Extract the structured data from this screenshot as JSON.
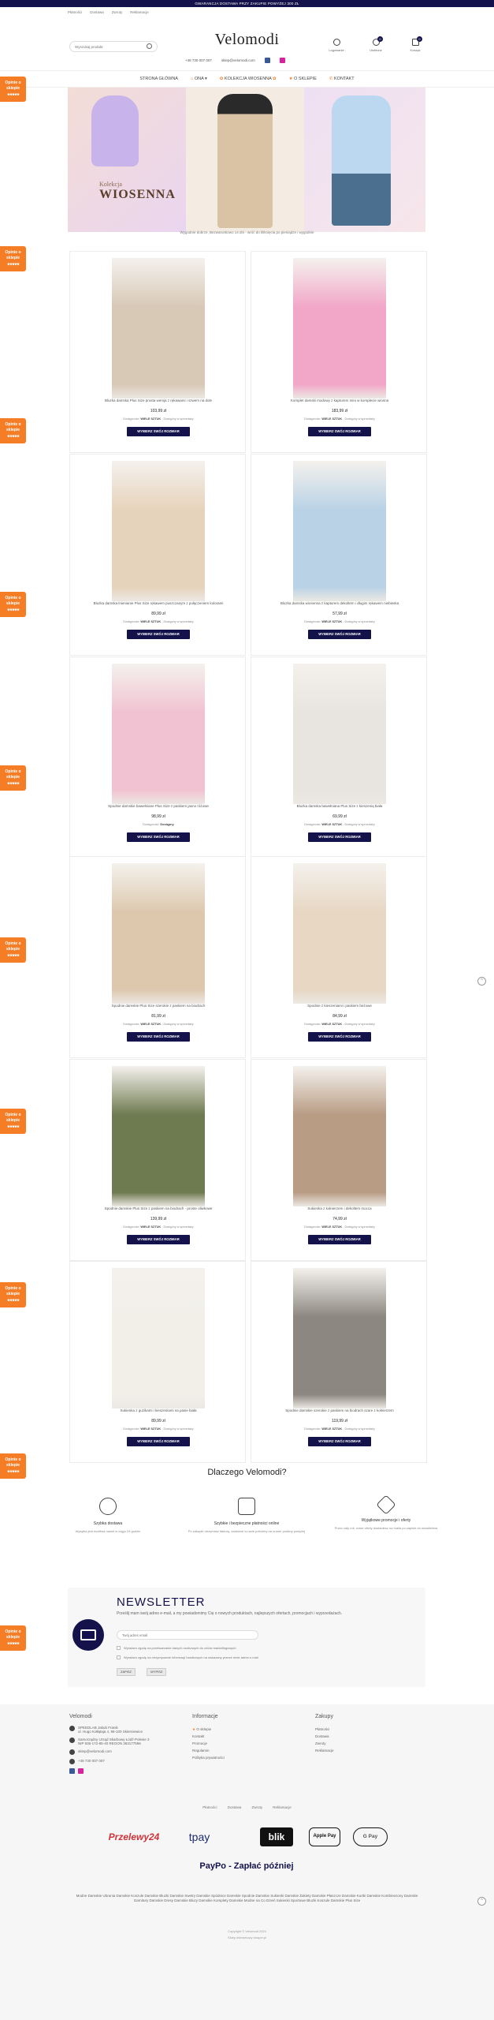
{
  "topbar": {
    "text": "GWARANCJA DOSTAWA PRZY ZAKUPIE POWYŻEJ 300 ZŁ"
  },
  "header": {
    "toplinks": [
      "Płatności",
      "Dostawa",
      "Zwroty",
      "Reklamacje"
    ],
    "logo": "Velomodi",
    "search_placeholder": "Wyszukaj produkt",
    "phone": "+48 730 007 007",
    "email": "sklep@velomodi.com",
    "icons": [
      {
        "name": "user-icon",
        "label": "Logowanie"
      },
      {
        "name": "heart-icon",
        "label": "Ulubione",
        "badge": "0"
      },
      {
        "name": "cart-icon",
        "label": "Koszyk",
        "badge": "0"
      }
    ]
  },
  "nav": {
    "items": [
      "STRONA GŁÓWNA",
      "ONA",
      "KOLEKCJA WIOSENNA",
      "O SKLEPIE",
      "KONTAKT"
    ]
  },
  "banner": {
    "small": "Kolekcja",
    "big": "WIOSENNA"
  },
  "subtitle": "Wygodnie dobrze, Bezwarunkowo 14 dni - wróć do kliknięcia po pieniądze i wygodnie",
  "side_tab": {
    "label": "Opinie o sklepie",
    "stars": "★★★★★"
  },
  "products": [
    {
      "name": "Bluzka damska Plus Size prosta wersja z rękawami i szwem na dole",
      "price": "103,99 zł",
      "avail_label": "Dostępność:",
      "avail_value": "WIELE SZTUK",
      "avail_extra": " - Dostępny w sprzedaży",
      "button": "WYBIERZ SWÓJ ROZMIAR",
      "color": "#d8c8b6"
    },
    {
      "name": "Komplet damski modowy z kapturem mini w komplecie wiosna",
      "price": "183,99 zł",
      "avail_label": "Dostępność:",
      "avail_value": "WIELE SZTUK",
      "avail_extra": " - Dostępny w sprzedaży",
      "button": "WYBIERZ SWÓJ ROZMIAR",
      "color": "#f2a7c8"
    },
    {
      "name": "Bluzka damska lnienianie Plus Size rękawem puszczanym z połączeniem kolorami",
      "price": "89,99 zł",
      "avail_label": "Dostępność:",
      "avail_value": "WIELE SZTUK",
      "avail_extra": " - Dostępny w sprzedaży",
      "button": "WYBIERZ SWÓJ ROZMIAR",
      "color": "#e6d3bc"
    },
    {
      "name": "Bluzka damska wiosenna z kapturem dekoltem i długim rękawem niebieska",
      "price": "57,99 zł",
      "avail_label": "Dostępność:",
      "avail_value": "WIELE SZTUK",
      "avail_extra": " - Dostępny w sprzedaży",
      "button": "WYBIERZ SWÓJ ROZMIAR",
      "color": "#b9d2e6"
    },
    {
      "name": "Spodnie damskie bawełniane Plus Size z paskiem jasno różowe",
      "price": "98,99 zł",
      "avail_label": "Dostępność:",
      "avail_value": "Dostępny",
      "avail_extra": "",
      "button": "WYBIERZ SWÓJ ROZMIAR",
      "color": "#f1c2d2"
    },
    {
      "name": "Bluzka damska bawełniana Plus Size z kieszenią biała",
      "price": "69,99 zł",
      "avail_label": "Dostępność:",
      "avail_value": "WIELE SZTUK",
      "avail_extra": " - Dostępny w sprzedaży",
      "button": "WYBIERZ SWÓJ ROZMIAR",
      "color": "#e8e4df"
    },
    {
      "name": "Spodnie damskie Plus Size szerokie z paskiem na biodrach",
      "price": "81,99 zł",
      "avail_label": "Dostępność:",
      "avail_value": "WIELE SZTUK",
      "avail_extra": " - Dostępny w sprzedaży",
      "button": "WYBIERZ SWÓJ ROZMIAR",
      "color": "#ddc8ae"
    },
    {
      "name": "Spodnie z kieszeniami i paskiem beżowe",
      "price": "84,99 zł",
      "avail_label": "Dostępność:",
      "avail_value": "WIELE SZTUK",
      "avail_extra": " - Dostępny w sprzedaży",
      "button": "WYBIERZ SWÓJ ROZMIAR",
      "color": "#e7d7c3"
    },
    {
      "name": "Spodnie damskie Plus Size z paskiem na biodrach - proste oliwkowe",
      "price": "139,99 zł",
      "avail_label": "Dostępność:",
      "avail_value": "WIELE SZTUK",
      "avail_extra": " - Dostępny w sprzedaży",
      "button": "WYBIERZ SWÓJ ROZMIAR",
      "color": "#6e7a4f"
    },
    {
      "name": "Sukienka z kołnierzem i dekoltem mocca",
      "price": "74,99 zł",
      "avail_label": "Dostępność:",
      "avail_value": "WIELE SZTUK",
      "avail_extra": " - Dostępny w sprzedaży",
      "button": "WYBIERZ SWÓJ ROZMIAR",
      "color": "#b89c84"
    },
    {
      "name": "Sukienka z guzikami i kieszeniami na pasie biała",
      "price": "89,99 zł",
      "avail_label": "Dostępność:",
      "avail_value": "WIELE SZTUK",
      "avail_extra": " - Dostępny w sprzedaży",
      "button": "WYBIERZ SWÓJ ROZMIAR",
      "color": "#f2efe9"
    },
    {
      "name": "Spodnie damskie szerokie z paskiem na biodrach szare z kołnierzem",
      "price": "119,99 zł",
      "avail_label": "Dostępność:",
      "avail_value": "WIELE SZTUK",
      "avail_extra": " - Dostępny w sprzedaży",
      "button": "WYBIERZ SWÓJ ROZMIAR",
      "color": "#8c8780"
    }
  ],
  "why": {
    "title": "Dlaczego Velomodi?",
    "items": [
      {
        "icon": "delivery-icon",
        "title": "Szybka dostawa",
        "desc": "Wysyłka jest możliwa nawet w ciągu 24 godzin"
      },
      {
        "icon": "wallet-icon",
        "title": "Szybkie i bezpieczne płatności online",
        "desc": "Po zakupie otrzymasz fakturę, zadzwoń w razie potrzeby na numer podany powyżej"
      },
      {
        "icon": "tag-icon",
        "title": "Wyjątkowe promocje i oferty",
        "desc": "Przez cały rok, nowe oferty dostaniesz na maila po zapisie do newslettera"
      }
    ]
  },
  "newsletter": {
    "title": "NEWSLETTER",
    "desc": "Prześlij mam swój adres e-mail, a my powiadomimy Cię o nowych produktach, najlepszych ofertach, promocjach i wyprzedażach.",
    "input_placeholder": "Twój adres email",
    "check1": "Wyrażam zgodę na przetwarzanie danych osobowych do celów marketingowych",
    "check2": "Wyrażam zgodę na otrzymywanie informacji handlowych na wskazany przeze mnie adres e-mail",
    "btn_subscribe": "ZAPISZ",
    "btn_unsubscribe": "WYPISZ"
  },
  "footer": {
    "col1_title": "Velomodi",
    "company_lines": [
      "SPEEDLAB Jakub Franik",
      "ul. Hugo Kołłątaja 4, 96-100 Skierniewice"
    ],
    "registry_lines": [
      "Samorządny Urząd Skarbowy Łódź-Polesie 3",
      "NIP 836-172-85-40 REGON 363177556"
    ],
    "email": "sklep@velomodi.com",
    "phone": "+48 730 007 007",
    "col2_title": "Informacje",
    "col2_links": [
      "O sklepie",
      "Kontakt",
      "Promocje",
      "Regulamin",
      "Polityka prywatności"
    ],
    "col3_title": "Zakupy",
    "col3_links": [
      "Płatności",
      "Dostawa",
      "Zwroty",
      "Reklamacje"
    ],
    "bottom_links": [
      "Płatności",
      "Dostawa",
      "Zwroty",
      "Reklamacje"
    ],
    "payments": [
      "Przelewy24",
      "tpay",
      "blik",
      "Apple Pay",
      "G Pay",
      "PayPo - Zapłać później"
    ],
    "tags": "Modne Damskie Ubrania Damskie Koszule Damskie Bluzki Damskie Swetry Damskie Spódnice Damskie Spodnie Damskie Sukienki Damskie Żakiety Damskie Płaszcze Damskie Kurtki Damskie Kombinezony Damskie Garnitury Damskie Dresy Damskie Bluzy Damskie Komplety Damskie Modne na Co Dzień Sukienki Sportowe Bluzki Koszule Damskie Plus Size",
    "copyright": "Copyright © Velomodi 2024",
    "powered": "Sklep internetowy shoper.pl"
  }
}
